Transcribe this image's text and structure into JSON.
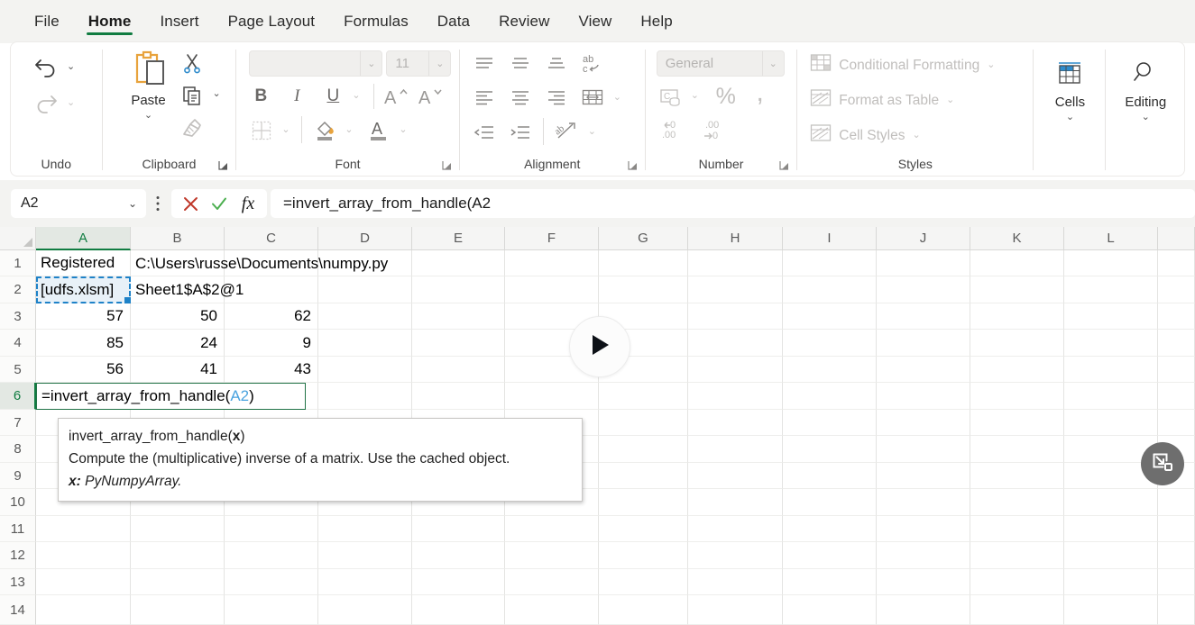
{
  "app": {
    "name": "Microsoft Excel",
    "accent_green": "#107c41",
    "selection_green": "#217346",
    "copy_border_blue": "#1e82c8",
    "ref_blue": "#4aa3df"
  },
  "ribbon": {
    "tabs": [
      {
        "label": "File",
        "active": false
      },
      {
        "label": "Home",
        "active": true
      },
      {
        "label": "Insert",
        "active": false
      },
      {
        "label": "Page Layout",
        "active": false
      },
      {
        "label": "Formulas",
        "active": false
      },
      {
        "label": "Data",
        "active": false
      },
      {
        "label": "Review",
        "active": false
      },
      {
        "label": "View",
        "active": false
      },
      {
        "label": "Help",
        "active": false
      }
    ],
    "groups": {
      "undo": {
        "label": "Undo",
        "undo_icon": "undo-arrow-icon",
        "redo_icon": "redo-arrow-icon"
      },
      "clipboard": {
        "label": "Clipboard",
        "paste_label": "Paste",
        "paste_icon": "clipboard-paste-icon",
        "cut_icon": "scissors-icon",
        "copy_icon": "copy-pages-icon",
        "format_painter_icon": "paintbrush-icon",
        "dialog_launcher_icon": "dialog-launcher-icon"
      },
      "font": {
        "label": "Font",
        "font_name_value": "",
        "font_name_placeholder": "",
        "font_size_value": "11",
        "bold_label": "B",
        "italic_label": "I",
        "underline_label": "U",
        "grow_font_icon": "increase-font-size-icon",
        "shrink_font_icon": "decrease-font-size-icon",
        "borders_icon": "borders-icon",
        "fill_color_icon": "fill-color-icon",
        "font_color_icon": "font-color-icon",
        "dialog_launcher_icon": "dialog-launcher-icon"
      },
      "alignment": {
        "label": "Alignment",
        "align_top_icon": "align-top-icon",
        "align_middle_icon": "align-middle-icon",
        "align_bottom_icon": "align-bottom-icon",
        "wrap_text_icon": "wrap-text-icon",
        "align_left_icon": "align-left-icon",
        "align_center_icon": "align-center-icon",
        "align_right_icon": "align-right-icon",
        "merge_cells_icon": "merge-and-center-icon",
        "decrease_indent_icon": "decrease-indent-icon",
        "increase_indent_icon": "increase-indent-icon",
        "orientation_icon": "text-orientation-icon",
        "dialog_launcher_icon": "dialog-launcher-icon"
      },
      "number": {
        "label": "Number",
        "format_value": "General",
        "accounting_icon": "accounting-number-format-icon",
        "percent_icon": "percent-style-icon",
        "comma_icon": "comma-style-icon",
        "decrease_decimal_icon": "decrease-decimal-icon",
        "increase_decimal_icon": "increase-decimal-icon",
        "dialog_launcher_icon": "dialog-launcher-icon"
      },
      "styles": {
        "label": "Styles",
        "items": [
          {
            "label": "Conditional Formatting",
            "icon": "conditional-formatting-icon"
          },
          {
            "label": "Format as Table",
            "icon": "format-as-table-icon"
          },
          {
            "label": "Cell Styles",
            "icon": "cell-styles-icon"
          }
        ]
      },
      "cells": {
        "label": "Cells",
        "icon": "insert-cells-icon"
      },
      "editing": {
        "label": "Editing",
        "icon": "find-magnifier-icon"
      }
    }
  },
  "formula_bar": {
    "name_box_value": "A2",
    "name_box_chevron_icon": "chevron-down-icon",
    "kebab_icon": "more-options-icon",
    "cancel_icon": "cancel-x-icon",
    "confirm_icon": "confirm-check-icon",
    "insert_function_icon": "fx-insert-function-icon",
    "formula_value": "=invert_array_from_handle(A2"
  },
  "grid": {
    "columns": [
      "A",
      "B",
      "C",
      "D",
      "E",
      "F",
      "G",
      "H",
      "I",
      "J",
      "K",
      "L"
    ],
    "selected_column": "A",
    "rows": [
      "1",
      "2",
      "3",
      "4",
      "5",
      "6",
      "7",
      "8",
      "9",
      "10",
      "11",
      "12",
      "13",
      "14"
    ],
    "selected_row": "6",
    "cells": {
      "A1": "Registered",
      "B1_overflow": "C:\\Users\\russe\\Documents\\numpy.py",
      "A1_full": "Registered C:\\Users\\russe\\Documents\\numpy.py",
      "A2": "[udfs.xlsm]",
      "A2_overflow": "Sheet1$A$2@1",
      "A2_full": "[udfs.xlsm]Sheet1$A$2@1",
      "A3": "57",
      "B3": "50",
      "C3": "62",
      "A4": "85",
      "B4": "24",
      "C4": "9",
      "A5": "56",
      "B5": "41",
      "C5": "43"
    },
    "active_cell": {
      "address": "A6",
      "formula_prefix": "=invert_array_from_handle(",
      "formula_reference": "A2",
      "formula_suffix": ")"
    },
    "copy_marquee_cell": "A2"
  },
  "tooltip": {
    "signature_name": "invert_array_from_handle(",
    "signature_param": "x",
    "signature_close": ")",
    "description": "Compute the (multiplicative) inverse of a matrix. Use the cached object.",
    "param_label": "x:",
    "param_type": "PyNumpyArray."
  },
  "overlays": {
    "play_button_icon": "play-triangle-icon",
    "floating_button_icon": "restore-down-window-icon"
  }
}
